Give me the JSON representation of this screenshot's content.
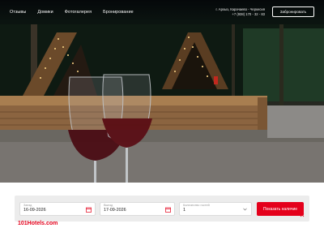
{
  "nav": {
    "items": [
      {
        "label": "Отзывы"
      },
      {
        "label": "Домики"
      },
      {
        "label": "Фотогалерея"
      },
      {
        "label": "Бронирование"
      }
    ]
  },
  "contact": {
    "address": "г. Архыз, Карачаево - Черкесия",
    "phone": "+7 (938) 170 - 32 - 83"
  },
  "header": {
    "book_label": "Забронировать"
  },
  "search": {
    "checkin_label": "Заезд",
    "checkin_value": "16-09-2026",
    "checkout_label": "Выезд",
    "checkout_value": "17-09-2026",
    "guests_label": "Количество гостей",
    "guests_value": "1",
    "submit_label": "Показать наличие"
  },
  "brand": {
    "name": "101Hotels.com"
  },
  "colors": {
    "accent": "#e4001b",
    "panel": "#ececec"
  },
  "icons": [
    "calendar-icon",
    "chevron-down-icon",
    "close-icon"
  ]
}
